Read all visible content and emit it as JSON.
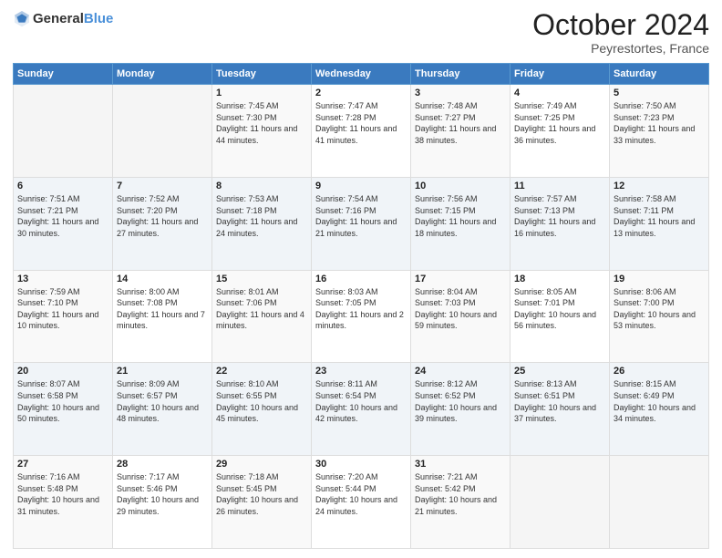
{
  "header": {
    "logo": {
      "general": "General",
      "blue": "Blue"
    },
    "title": "October 2024",
    "location": "Peyrestortes, France"
  },
  "days_of_week": [
    "Sunday",
    "Monday",
    "Tuesday",
    "Wednesday",
    "Thursday",
    "Friday",
    "Saturday"
  ],
  "weeks": [
    {
      "cells": [
        {
          "day": "",
          "info": ""
        },
        {
          "day": "",
          "info": ""
        },
        {
          "day": "1",
          "info": "Sunrise: 7:45 AM\nSunset: 7:30 PM\nDaylight: 11 hours and 44 minutes."
        },
        {
          "day": "2",
          "info": "Sunrise: 7:47 AM\nSunset: 7:28 PM\nDaylight: 11 hours and 41 minutes."
        },
        {
          "day": "3",
          "info": "Sunrise: 7:48 AM\nSunset: 7:27 PM\nDaylight: 11 hours and 38 minutes."
        },
        {
          "day": "4",
          "info": "Sunrise: 7:49 AM\nSunset: 7:25 PM\nDaylight: 11 hours and 36 minutes."
        },
        {
          "day": "5",
          "info": "Sunrise: 7:50 AM\nSunset: 7:23 PM\nDaylight: 11 hours and 33 minutes."
        }
      ]
    },
    {
      "cells": [
        {
          "day": "6",
          "info": "Sunrise: 7:51 AM\nSunset: 7:21 PM\nDaylight: 11 hours and 30 minutes."
        },
        {
          "day": "7",
          "info": "Sunrise: 7:52 AM\nSunset: 7:20 PM\nDaylight: 11 hours and 27 minutes."
        },
        {
          "day": "8",
          "info": "Sunrise: 7:53 AM\nSunset: 7:18 PM\nDaylight: 11 hours and 24 minutes."
        },
        {
          "day": "9",
          "info": "Sunrise: 7:54 AM\nSunset: 7:16 PM\nDaylight: 11 hours and 21 minutes."
        },
        {
          "day": "10",
          "info": "Sunrise: 7:56 AM\nSunset: 7:15 PM\nDaylight: 11 hours and 18 minutes."
        },
        {
          "day": "11",
          "info": "Sunrise: 7:57 AM\nSunset: 7:13 PM\nDaylight: 11 hours and 16 minutes."
        },
        {
          "day": "12",
          "info": "Sunrise: 7:58 AM\nSunset: 7:11 PM\nDaylight: 11 hours and 13 minutes."
        }
      ]
    },
    {
      "cells": [
        {
          "day": "13",
          "info": "Sunrise: 7:59 AM\nSunset: 7:10 PM\nDaylight: 11 hours and 10 minutes."
        },
        {
          "day": "14",
          "info": "Sunrise: 8:00 AM\nSunset: 7:08 PM\nDaylight: 11 hours and 7 minutes."
        },
        {
          "day": "15",
          "info": "Sunrise: 8:01 AM\nSunset: 7:06 PM\nDaylight: 11 hours and 4 minutes."
        },
        {
          "day": "16",
          "info": "Sunrise: 8:03 AM\nSunset: 7:05 PM\nDaylight: 11 hours and 2 minutes."
        },
        {
          "day": "17",
          "info": "Sunrise: 8:04 AM\nSunset: 7:03 PM\nDaylight: 10 hours and 59 minutes."
        },
        {
          "day": "18",
          "info": "Sunrise: 8:05 AM\nSunset: 7:01 PM\nDaylight: 10 hours and 56 minutes."
        },
        {
          "day": "19",
          "info": "Sunrise: 8:06 AM\nSunset: 7:00 PM\nDaylight: 10 hours and 53 minutes."
        }
      ]
    },
    {
      "cells": [
        {
          "day": "20",
          "info": "Sunrise: 8:07 AM\nSunset: 6:58 PM\nDaylight: 10 hours and 50 minutes."
        },
        {
          "day": "21",
          "info": "Sunrise: 8:09 AM\nSunset: 6:57 PM\nDaylight: 10 hours and 48 minutes."
        },
        {
          "day": "22",
          "info": "Sunrise: 8:10 AM\nSunset: 6:55 PM\nDaylight: 10 hours and 45 minutes."
        },
        {
          "day": "23",
          "info": "Sunrise: 8:11 AM\nSunset: 6:54 PM\nDaylight: 10 hours and 42 minutes."
        },
        {
          "day": "24",
          "info": "Sunrise: 8:12 AM\nSunset: 6:52 PM\nDaylight: 10 hours and 39 minutes."
        },
        {
          "day": "25",
          "info": "Sunrise: 8:13 AM\nSunset: 6:51 PM\nDaylight: 10 hours and 37 minutes."
        },
        {
          "day": "26",
          "info": "Sunrise: 8:15 AM\nSunset: 6:49 PM\nDaylight: 10 hours and 34 minutes."
        }
      ]
    },
    {
      "cells": [
        {
          "day": "27",
          "info": "Sunrise: 7:16 AM\nSunset: 5:48 PM\nDaylight: 10 hours and 31 minutes."
        },
        {
          "day": "28",
          "info": "Sunrise: 7:17 AM\nSunset: 5:46 PM\nDaylight: 10 hours and 29 minutes."
        },
        {
          "day": "29",
          "info": "Sunrise: 7:18 AM\nSunset: 5:45 PM\nDaylight: 10 hours and 26 minutes."
        },
        {
          "day": "30",
          "info": "Sunrise: 7:20 AM\nSunset: 5:44 PM\nDaylight: 10 hours and 24 minutes."
        },
        {
          "day": "31",
          "info": "Sunrise: 7:21 AM\nSunset: 5:42 PM\nDaylight: 10 hours and 21 minutes."
        },
        {
          "day": "",
          "info": ""
        },
        {
          "day": "",
          "info": ""
        }
      ]
    }
  ]
}
